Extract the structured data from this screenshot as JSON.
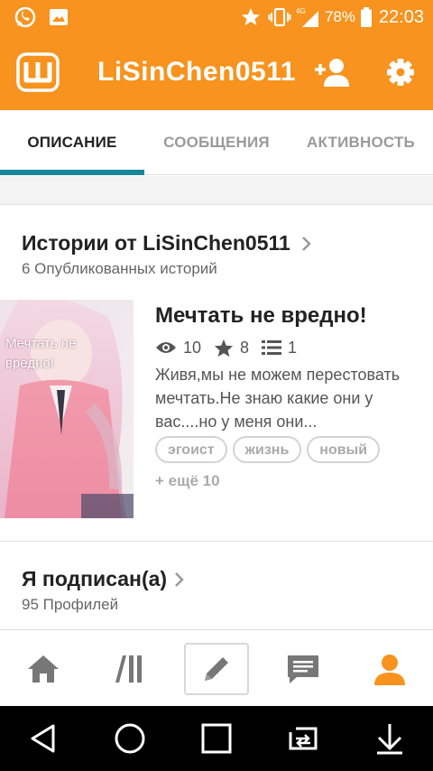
{
  "status_bar": {
    "network": "4G",
    "battery": "78%",
    "time": "22:03"
  },
  "toolbar": {
    "title": "LiSinChen0511"
  },
  "tabs": [
    {
      "label": "ОПИСАНИЕ",
      "active": true
    },
    {
      "label": "СООБЩЕНИЯ",
      "active": false
    },
    {
      "label": "АКТИВНОСТЬ",
      "active": false
    }
  ],
  "stories_section": {
    "title": "Истории от LiSinChen0511",
    "subtitle": "6 Опубликованных историй"
  },
  "story": {
    "cover_text": "Мечтать не вредно!",
    "title": "Мечтать не вредно!",
    "reads": "10",
    "votes": "8",
    "parts": "1",
    "description": "Живя,мы не можем перестовать мечтать.Не знаю какие они у вас....но у меня они...",
    "tags": [
      "эгоист",
      "жизнь",
      "новый"
    ],
    "more_tags": "+ ещё 10"
  },
  "following_section": {
    "title": "Я подписан(а)",
    "subtitle": "95 Профилей"
  },
  "colors": {
    "accent": "#f7931e",
    "tab_indicator": "#17889a"
  },
  "bottom_nav": [
    "home-icon",
    "library-icon",
    "write-icon",
    "messages-icon",
    "profile-icon"
  ],
  "system_nav": [
    "back-icon",
    "home-circle-icon",
    "recents-icon",
    "switch-icon",
    "notification-icon"
  ]
}
